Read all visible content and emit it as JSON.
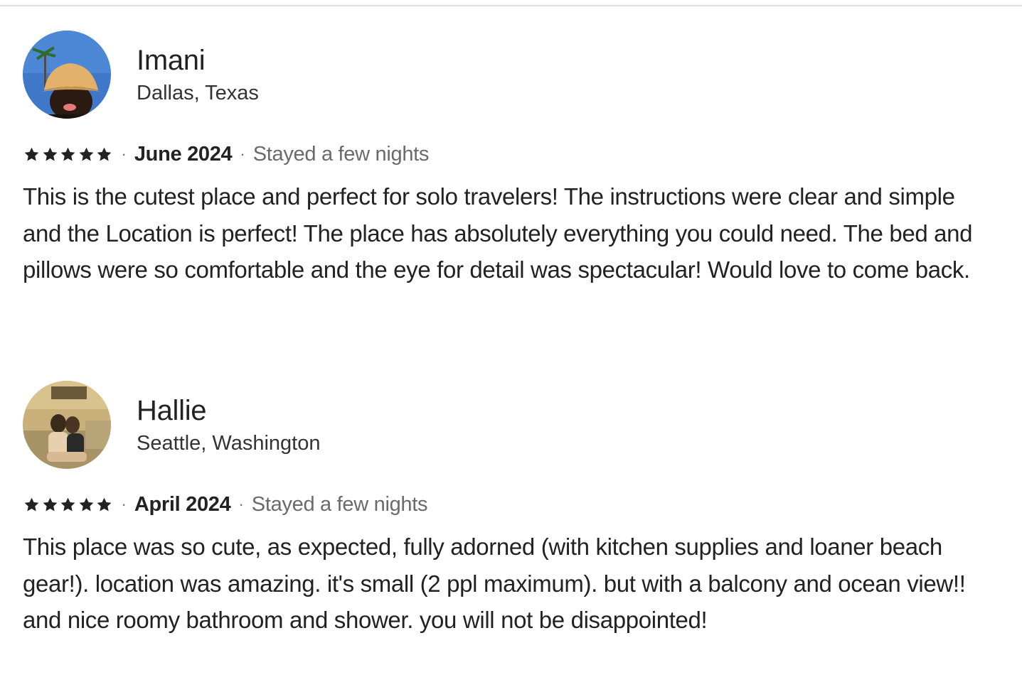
{
  "reviews": [
    {
      "name": "Imani",
      "location": "Dallas, Texas",
      "rating": 5,
      "date": "June 2024",
      "stay": "Stayed a few nights",
      "text": "This is the cutest place and perfect for solo travelers! The instructions were clear and simple and the Location is perfect! The place has absolutely everything you could need. The bed and pillows were so comfortable and the eye for detail was spectacular! Would love to come back.",
      "avatar_colors": {
        "background": "#3f78c8",
        "hat": "#e3b26a",
        "face": "#2b1a12"
      }
    },
    {
      "name": "Hallie",
      "location": "Seattle, Washington",
      "rating": 5,
      "date": "April 2024",
      "stay": "Stayed a few nights",
      "text": "This place was so cute, as expected, fully adorned (with kitchen supplies and loaner beach gear!). location was amazing. it's small (2 ppl maximum). but with a balcony and ocean view!! and nice roomy bathroom and shower. you will not be disappointed!",
      "avatar_colors": {
        "background": "#c9b07a",
        "couch": "#a89366",
        "people": "#3a2a1c"
      }
    }
  ],
  "separator": "·",
  "icons": {
    "star": "star-icon",
    "avatar": "avatar"
  }
}
